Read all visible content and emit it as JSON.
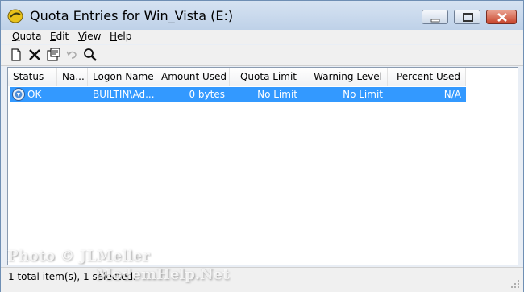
{
  "window": {
    "title": "Quota Entries for Win_Vista (E:)"
  },
  "menubar": [
    {
      "label": "Quota",
      "accel": "Q",
      "rest": "uota"
    },
    {
      "label": "Edit",
      "accel": "E",
      "rest": "dit"
    },
    {
      "label": "View",
      "accel": "V",
      "rest": "iew"
    },
    {
      "label": "Help",
      "accel": "H",
      "rest": "elp"
    }
  ],
  "toolbar": {
    "icons": [
      "new-entry-icon",
      "delete-icon",
      "properties-icon",
      "undo-icon",
      "find-icon"
    ]
  },
  "table": {
    "columns": [
      "Status",
      "Na...",
      "Logon Name",
      "Amount Used",
      "Quota Limit",
      "Warning Level",
      "Percent Used"
    ],
    "rows": [
      {
        "status": "OK",
        "name": "",
        "logon_name": "BUILTIN\\Ad...",
        "amount_used": "0 bytes",
        "quota_limit": "No Limit",
        "warning_level": "No Limit",
        "percent_used": "N/A",
        "selected": true
      }
    ]
  },
  "statusbar": {
    "text": "1 total item(s), 1 selected."
  },
  "watermark": {
    "line1": "Photo © JLMeller",
    "line2": "ModemHelp.Net"
  }
}
